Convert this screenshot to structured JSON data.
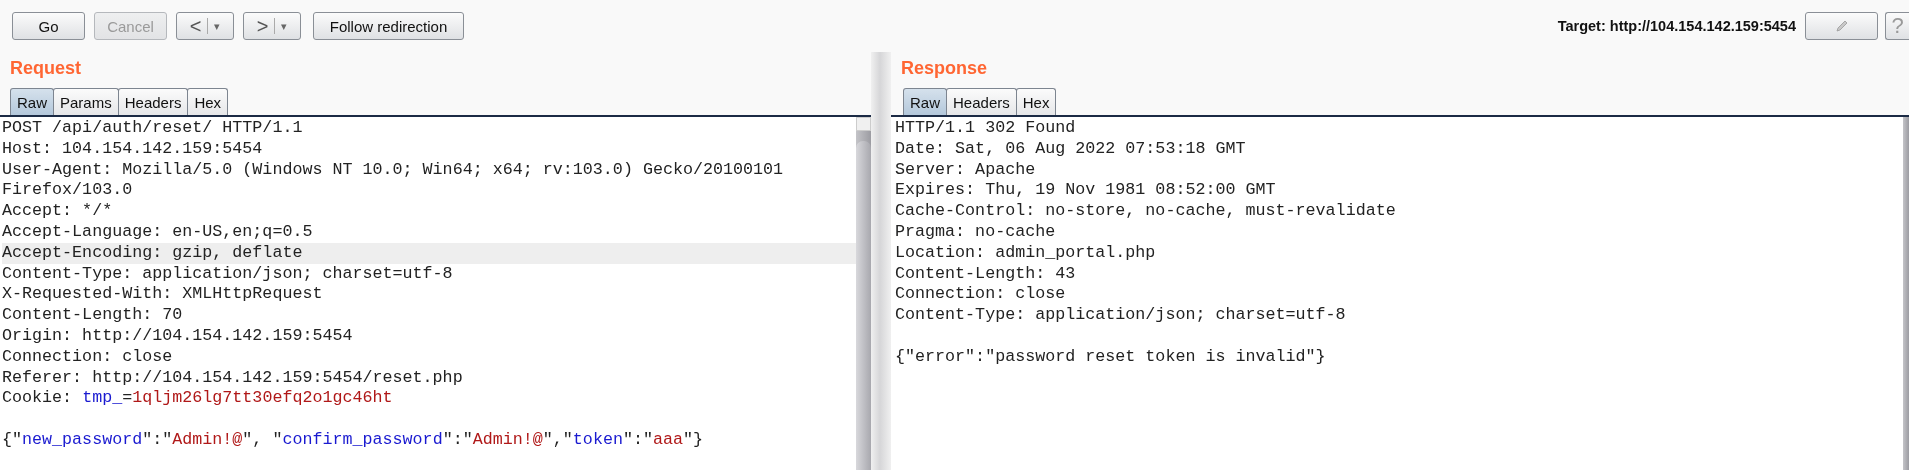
{
  "toolbar": {
    "buttons": [
      {
        "label": "Go",
        "disabled": false
      },
      {
        "label": "Cancel",
        "disabled": true
      }
    ],
    "history": [
      {
        "glyph": "<",
        "menu": "▾"
      },
      {
        "glyph": ">",
        "menu": "▾"
      }
    ],
    "follow_button": "Follow redirection",
    "target": "Target: http://104.154.142.159:5454",
    "help": "?"
  },
  "request": {
    "title": "Request",
    "tabs": [
      {
        "label": "Raw",
        "selected": true
      },
      {
        "label": "Params",
        "selected": false
      },
      {
        "label": "Headers",
        "selected": false
      },
      {
        "label": "Hex",
        "selected": false
      }
    ],
    "lines": [
      {
        "kind": "plain",
        "text": "POST /api/auth/reset/ HTTP/1.1",
        "highlighted": false
      },
      {
        "kind": "plain",
        "text": "Host: 104.154.142.159:5454",
        "highlighted": false
      },
      {
        "kind": "plain",
        "text": "User-Agent: Mozilla/5.0 (Windows NT 10.0; Win64; x64; rv:103.0) Gecko/20100101",
        "highlighted": false
      },
      {
        "kind": "plain",
        "text": "Firefox/103.0",
        "highlighted": false
      },
      {
        "kind": "plain",
        "text": "Accept: */*",
        "highlighted": false
      },
      {
        "kind": "plain",
        "text": "Accept-Language: en-US,en;q=0.5",
        "highlighted": false
      },
      {
        "kind": "plain",
        "text": "Accept-Encoding: gzip, deflate",
        "highlighted": true
      },
      {
        "kind": "plain",
        "text": "Content-Type: application/json; charset=utf-8",
        "highlighted": false
      },
      {
        "kind": "plain",
        "text": "X-Requested-With: XMLHttpRequest",
        "highlighted": false
      },
      {
        "kind": "plain",
        "text": "Content-Length: 70",
        "highlighted": false
      },
      {
        "kind": "plain",
        "text": "Origin: http://104.154.142.159:5454",
        "highlighted": false
      },
      {
        "kind": "plain",
        "text": "Connection: close",
        "highlighted": false
      },
      {
        "kind": "plain",
        "text": "Referer: http://104.154.142.159:5454/reset.php",
        "highlighted": false
      },
      {
        "kind": "rich",
        "highlighted": false,
        "segments": [
          {
            "kind": "text",
            "text": "Cookie: "
          },
          {
            "kind": "name",
            "text": "tmp_"
          },
          {
            "kind": "text",
            "text": "="
          },
          {
            "kind": "value",
            "text": "1qljm26lg7tt30efq2o1gc46ht"
          }
        ]
      },
      {
        "kind": "blank",
        "highlighted": false
      },
      {
        "kind": "rich",
        "highlighted": false,
        "segments": [
          {
            "kind": "text",
            "text": "{\""
          },
          {
            "kind": "name",
            "text": "new_password"
          },
          {
            "kind": "text",
            "text": "\":\""
          },
          {
            "kind": "value",
            "text": "Admin!@"
          },
          {
            "kind": "text",
            "text": "\", \""
          },
          {
            "kind": "name",
            "text": "confirm_password"
          },
          {
            "kind": "text",
            "text": "\":\""
          },
          {
            "kind": "value",
            "text": "Admin!@"
          },
          {
            "kind": "text",
            "text": "\",\""
          },
          {
            "kind": "name",
            "text": "token"
          },
          {
            "kind": "text",
            "text": "\":\""
          },
          {
            "kind": "value",
            "text": "aaa"
          },
          {
            "kind": "text",
            "text": "\"}"
          }
        ]
      }
    ]
  },
  "response": {
    "title": "Response",
    "tabs": [
      {
        "label": "Raw",
        "selected": true
      },
      {
        "label": "Headers",
        "selected": false
      },
      {
        "label": "Hex",
        "selected": false
      }
    ],
    "lines": [
      {
        "kind": "plain",
        "text": "HTTP/1.1 302 Found",
        "highlighted": false
      },
      {
        "kind": "plain",
        "text": "Date: Sat, 06 Aug 2022 07:53:18 GMT",
        "highlighted": false
      },
      {
        "kind": "plain",
        "text": "Server: Apache",
        "highlighted": false
      },
      {
        "kind": "plain",
        "text": "Expires: Thu, 19 Nov 1981 08:52:00 GMT",
        "highlighted": false
      },
      {
        "kind": "plain",
        "text": "Cache-Control: no-store, no-cache, must-revalidate",
        "highlighted": false
      },
      {
        "kind": "plain",
        "text": "Pragma: no-cache",
        "highlighted": false
      },
      {
        "kind": "plain",
        "text": "Location: admin_portal.php",
        "highlighted": false
      },
      {
        "kind": "plain",
        "text": "Content-Length: 43",
        "highlighted": false
      },
      {
        "kind": "plain",
        "text": "Connection: close",
        "highlighted": false
      },
      {
        "kind": "plain",
        "text": "Content-Type: application/json; charset=utf-8",
        "highlighted": false
      },
      {
        "kind": "blank",
        "highlighted": false
      },
      {
        "kind": "plain",
        "text": "{\"error\":\"password reset token is invalid\"}",
        "highlighted": false
      }
    ]
  }
}
